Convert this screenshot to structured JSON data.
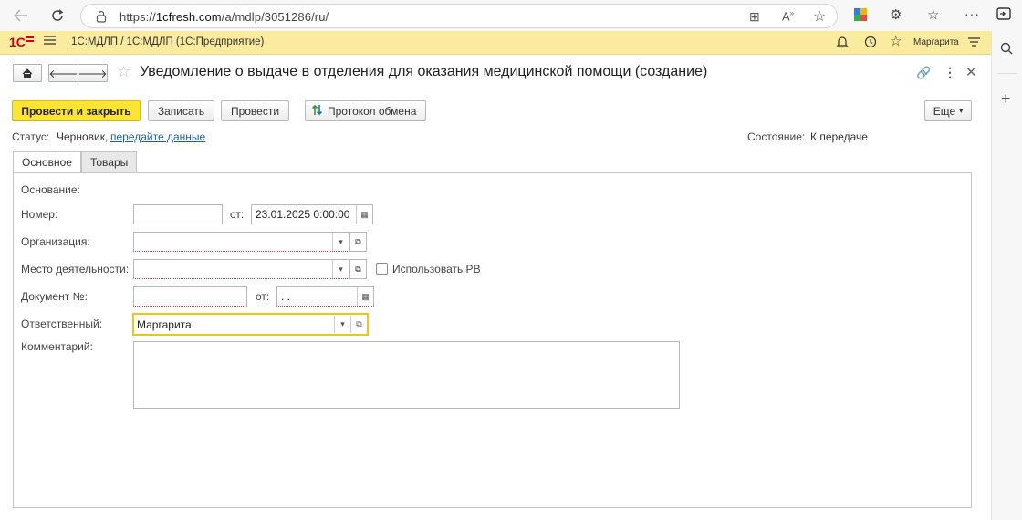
{
  "browser": {
    "url_prefix": "https://",
    "url_domain": "1cfresh.com",
    "url_path": "/a/mdlp/3051286/ru/"
  },
  "app": {
    "logo": "1С",
    "title": "1С:МДЛП / 1С:МДЛП  (1С:Предприятие)",
    "user": "Маргарита"
  },
  "document": {
    "title": "Уведомление о выдаче в отделения для оказания медицинской помощи (создание)"
  },
  "toolbar": {
    "post_close_label": "Провести и закрыть",
    "save_label": "Записать",
    "post_label": "Провести",
    "protocol_label": "Протокол обмена",
    "more_label": "Еще"
  },
  "status": {
    "label": "Статус:",
    "value": "Черновик,",
    "link": "передайте данные",
    "state_label": "Состояние:",
    "state_value": "К передаче"
  },
  "tabs": [
    {
      "label": "Основное",
      "active": true
    },
    {
      "label": "Товары",
      "active": false
    }
  ],
  "form": {
    "basis_label": "Основание:",
    "number_label": "Номер:",
    "number_value": "",
    "from_label": "от:",
    "date_value": "23.01.2025  0:00:00",
    "org_label": "Организация:",
    "org_value": "",
    "place_label": "Место деятельности:",
    "place_value": "",
    "use_rv_label": "Использовать РВ",
    "use_rv_checked": false,
    "docnum_label": "Документ №:",
    "docnum_value": "",
    "docdate_from_label": "от:",
    "docdate_value": " .  .",
    "responsible_label": "Ответственный:",
    "responsible_value": "Маргарита",
    "comment_label": "Комментарий:",
    "comment_value": ""
  },
  "colors": {
    "header_bg": "#fbeb9e",
    "primary_button": "#ffe434",
    "logo_red": "#d0021b",
    "link_blue": "#1f5fa8",
    "focus_border": "#f0c419"
  }
}
